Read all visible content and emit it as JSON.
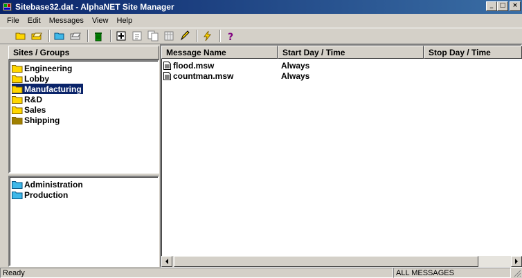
{
  "window": {
    "title": "Sitebase32.dat - AlphaNET Site Manager",
    "minimize_label": "_",
    "maximize_label": "□",
    "close_label": "×"
  },
  "menu": [
    "File",
    "Edit",
    "Messages",
    "View",
    "Help"
  ],
  "toolbar": {
    "icons": [
      "open-folder-icon",
      "open-file-icon",
      "folder-icon",
      "folder-add-icon",
      "trash-icon",
      "new-message-icon",
      "message-icon",
      "copy-icon",
      "schedule-icon",
      "edit-pencil-icon",
      "lightning-icon",
      "help-icon"
    ]
  },
  "sites_groups": {
    "header": "Sites / Groups",
    "sites": [
      {
        "label": "Engineering",
        "selected": false
      },
      {
        "label": "Lobby",
        "selected": false
      },
      {
        "label": "Manufacturing",
        "selected": true
      },
      {
        "label": "R&D",
        "selected": false
      },
      {
        "label": "Sales",
        "selected": false
      },
      {
        "label": "Shipping",
        "selected": false
      }
    ],
    "groups": [
      {
        "label": "Administration"
      },
      {
        "label": "Production"
      }
    ]
  },
  "messages": {
    "columns": [
      "Message Name",
      "Start Day / Time",
      "Stop Day / Time"
    ],
    "rows": [
      {
        "name": "flood.msw",
        "start": "Always",
        "stop": ""
      },
      {
        "name": "countman.msw",
        "start": "Always",
        "stop": ""
      }
    ]
  },
  "status": {
    "left": "Ready",
    "right": "ALL MESSAGES"
  },
  "colors": {
    "titlebar": "#0a246a",
    "selection": "#0a246a",
    "chrome": "#d4d0c8",
    "folder_yellow": "#ffd700"
  }
}
